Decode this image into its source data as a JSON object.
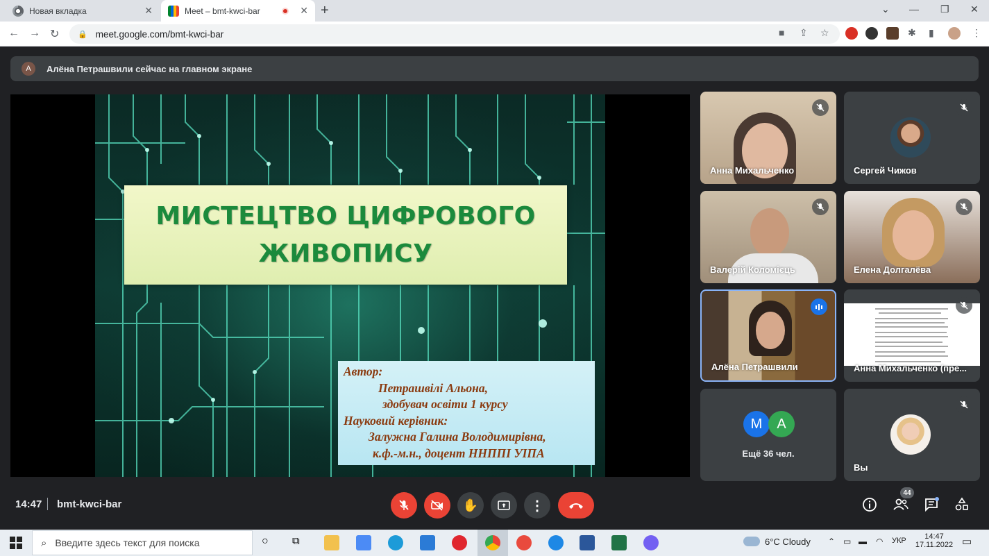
{
  "browser": {
    "tabs": [
      {
        "title": "Новая вкладка",
        "active": false
      },
      {
        "title": "Meet – bmt-kwci-bar",
        "active": true
      }
    ],
    "url": "meet.google.com/bmt-kwci-bar"
  },
  "banner": {
    "avatar_letter": "A",
    "text": "Алёна Петрашвили сейчас на главном экране"
  },
  "slide": {
    "title_line1": "МИСТЕЦТВО ЦИФРОВОГО",
    "title_line2": "ЖИВОПИСУ",
    "author_lines": [
      "Автор:",
      "Петрашвілі Альона,",
      "здобувач освіти 1 курсу",
      "Науковий керівник:",
      "Залужна Галина Володимирівна,",
      "к.ф.-м.н., доцент ННППІ УІПА"
    ]
  },
  "participants": [
    {
      "name": "Анна Михальченко",
      "muted": true
    },
    {
      "name": "Сергей Чижов",
      "muted": true
    },
    {
      "name": "Валерій Коломієць",
      "muted": true
    },
    {
      "name": "Елена Долгалёва",
      "muted": true
    },
    {
      "name": "Алёна Петрашвили",
      "muted": false,
      "speaking": true
    },
    {
      "name": "Анна Михальченко (пре...",
      "muted": true
    },
    {
      "name": "Ещё 36 чел.",
      "avatars": [
        "M",
        "A"
      ]
    },
    {
      "name": "Вы",
      "muted": true
    }
  ],
  "bottom_bar": {
    "time": "14:47",
    "meeting_code": "bmt-kwci-bar",
    "participants_count": "44"
  },
  "taskbar": {
    "search_placeholder": "Введите здесь текст для поиска",
    "weather": "6°C  Cloudy",
    "language": "УКР",
    "clock_time": "14:47",
    "clock_date": "17.11.2022"
  },
  "colors": {
    "meet_bg": "#202124",
    "tile_bg": "#3c4043",
    "danger": "#ea4335",
    "accent": "#1a73e8",
    "title_green": "#1b8a3c",
    "author_brown": "#8a3a0f"
  }
}
